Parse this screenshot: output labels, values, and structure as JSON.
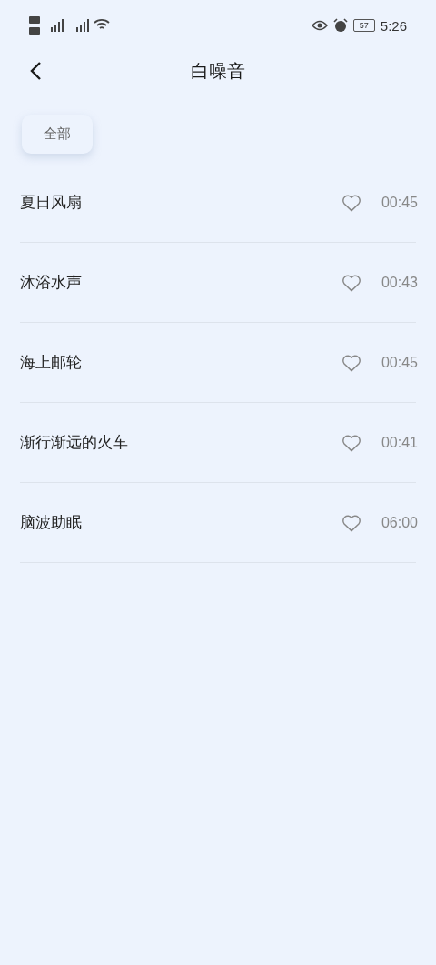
{
  "status_bar": {
    "battery": "57",
    "time": "5:26"
  },
  "header": {
    "title": "白噪音"
  },
  "tabs": [
    {
      "label": "全部",
      "selected": true
    }
  ],
  "tracks": [
    {
      "name": "夏日风扇",
      "favorite": false,
      "duration": "00:45"
    },
    {
      "name": "沐浴水声",
      "favorite": false,
      "duration": "00:43"
    },
    {
      "name": "海上邮轮",
      "favorite": false,
      "duration": "00:45"
    },
    {
      "name": "渐行渐远的火车",
      "favorite": false,
      "duration": "00:41"
    },
    {
      "name": "脑波助眠",
      "favorite": false,
      "duration": "06:00"
    }
  ]
}
